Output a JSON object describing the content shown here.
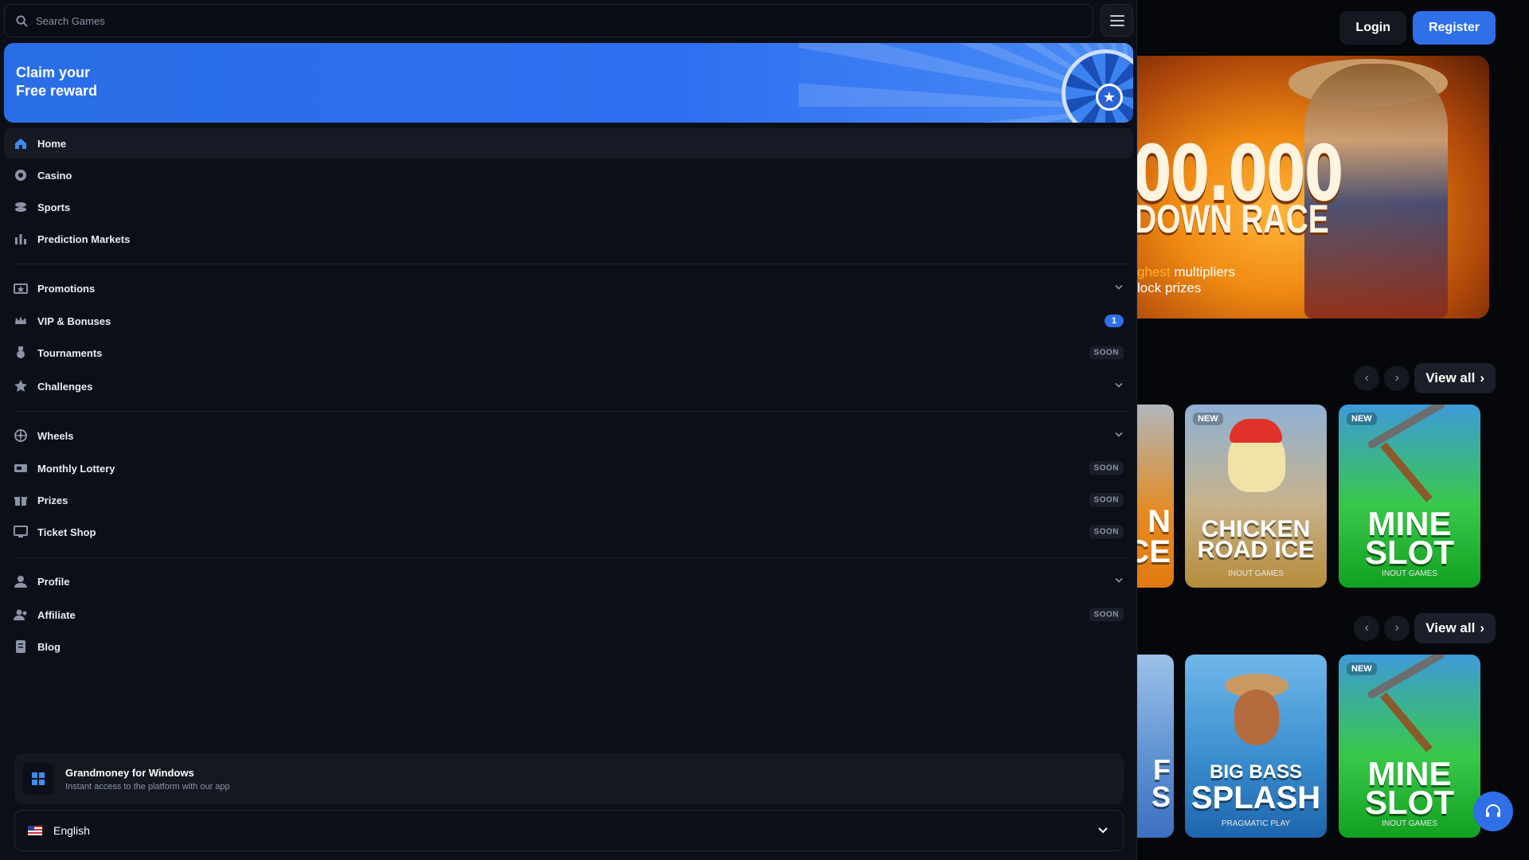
{
  "search": {
    "placeholder": "Search Games"
  },
  "promo": {
    "line1": "Claim your",
    "line2": "Free reward"
  },
  "nav_main": [
    {
      "label": "Home",
      "icon": "home-icon",
      "active": true
    },
    {
      "label": "Casino",
      "icon": "casino-chip-icon"
    },
    {
      "label": "Sports",
      "icon": "sports-icon"
    },
    {
      "label": "Prediction Markets",
      "icon": "chart-icon"
    }
  ],
  "nav_promos": [
    {
      "label": "Promotions",
      "icon": "ticket-icon",
      "trail": "chevron"
    },
    {
      "label": "VIP & Bonuses",
      "icon": "crown-icon",
      "trail": "badge",
      "badge": "1"
    },
    {
      "label": "Tournaments",
      "icon": "medal-icon",
      "trail": "soon"
    },
    {
      "label": "Challenges",
      "icon": "star-icon",
      "trail": "chevron"
    }
  ],
  "nav_rewards": [
    {
      "label": "Wheels",
      "icon": "wheel-icon",
      "trail": "chevron"
    },
    {
      "label": "Monthly Lottery",
      "icon": "lottery-ticket-icon",
      "trail": "soon"
    },
    {
      "label": "Prizes",
      "icon": "gift-icon",
      "trail": "soon"
    },
    {
      "label": "Ticket Shop",
      "icon": "monitor-icon",
      "trail": "soon"
    }
  ],
  "nav_account": [
    {
      "label": "Profile",
      "icon": "user-icon",
      "trail": "chevron"
    },
    {
      "label": "Affiliate",
      "icon": "users-icon",
      "trail": "soon"
    },
    {
      "label": "Blog",
      "icon": "document-icon"
    }
  ],
  "soon_label": "SOON",
  "app_banner": {
    "title": "Grandmoney for Windows",
    "subtitle": "Instant access to the platform with our app"
  },
  "language": {
    "selected": "English"
  },
  "header": {
    "login": "Login",
    "register": "Register"
  },
  "hero": {
    "big": "00.000",
    "race": "DOWN RACE",
    "sub1_highlight": "ghest",
    "sub1_rest": " multipliers",
    "sub2": "lock prizes"
  },
  "rows": [
    {
      "view_all": "View all"
    },
    {
      "view_all": "View all"
    }
  ],
  "cards_row1": [
    {
      "partial": true,
      "letters": "N\nCE"
    },
    {
      "badge": "NEW",
      "title1": "CHICKEN",
      "title2": "ROAD ICE",
      "provider": "INOUT GAMES"
    },
    {
      "badge": "NEW",
      "title1": "MINE",
      "title2": "SLOT",
      "provider": "INOUT GAMES"
    }
  ],
  "cards_row2": [
    {
      "partial": true,
      "letters": "F\nS"
    },
    {
      "title1": "BIG BASS",
      "title2": "SPLASH",
      "provider": "PRAGMATIC PLAY"
    },
    {
      "badge": "NEW",
      "title1": "MINE",
      "title2": "SLOT",
      "provider": "INOUT GAMES"
    }
  ],
  "colors": {
    "accent": "#2f6fe8",
    "sidebar_bg": "#0c0f17",
    "page_bg": "#05070b"
  }
}
